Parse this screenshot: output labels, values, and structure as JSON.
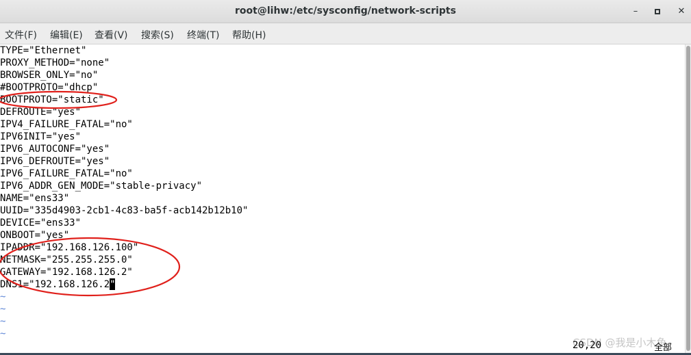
{
  "window": {
    "title": "root@lihw:/etc/sysconfig/network-scripts",
    "minimize_icon": "minimize-icon",
    "maximize_icon": "maximize-icon",
    "close_icon": "close-icon",
    "minimize_glyph": "–",
    "close_glyph": "✕"
  },
  "menu": {
    "items": [
      {
        "label": "文件(F)"
      },
      {
        "label": "编辑(E)"
      },
      {
        "label": "查看(V)"
      },
      {
        "label": "搜索(S)"
      },
      {
        "label": "终端(T)"
      },
      {
        "label": "帮助(H)"
      }
    ]
  },
  "editor": {
    "lines": [
      "TYPE=\"Ethernet\"",
      "PROXY_METHOD=\"none\"",
      "BROWSER_ONLY=\"no\"",
      "#BOOTPROTO=\"dhcp\"",
      "BOOTPROTO=\"static\"",
      "DEFROUTE=\"yes\"",
      "IPV4_FAILURE_FATAL=\"no\"",
      "IPV6INIT=\"yes\"",
      "IPV6_AUTOCONF=\"yes\"",
      "IPV6_DEFROUTE=\"yes\"",
      "IPV6_FAILURE_FATAL=\"no\"",
      "IPV6_ADDR_GEN_MODE=\"stable-privacy\"",
      "NAME=\"ens33\"",
      "UUID=\"335d4903-2cb1-4c83-ba5f-acb142b12b10\"",
      "DEVICE=\"ens33\"",
      "ONBOOT=\"yes\"",
      "IPADDR=\"192.168.126.100\"",
      "NETMASK=\"255.255.255.0\"",
      "GATEWAY=\"192.168.126.2\"",
      "DNS1=\"192.168.126.2"
    ],
    "last_line_tail": "\"",
    "empty_marker": "~",
    "empty_lines": 4,
    "tilde_color": "#5f87d7"
  },
  "status": {
    "position": "20,20",
    "scope": "全部"
  },
  "watermark": "CSDN @我是小木鱼",
  "annotation_color": "#e0201b"
}
